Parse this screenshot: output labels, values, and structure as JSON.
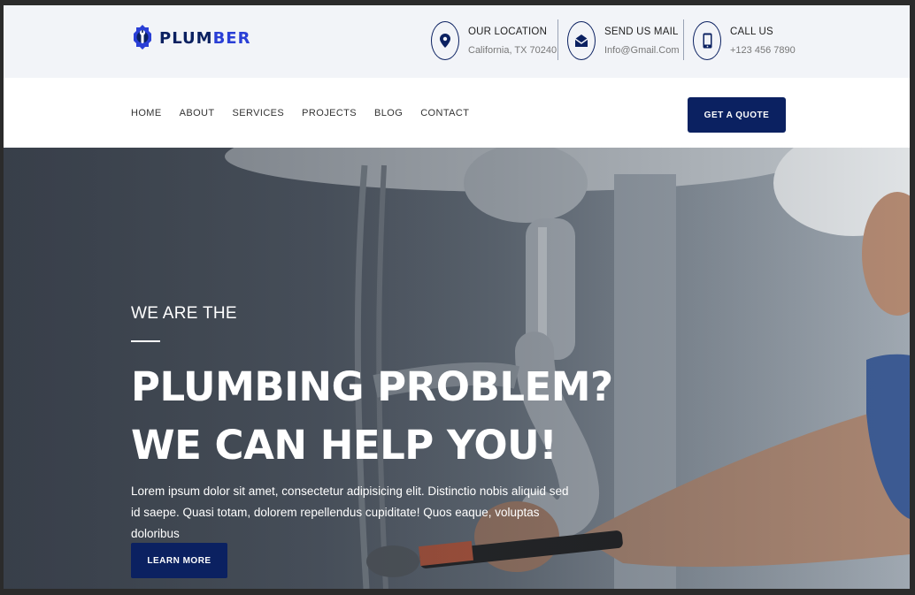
{
  "brand": {
    "name_part1": "PLUM",
    "name_part2": "BER",
    "primary_color": "#0b2161",
    "accent_color": "#2a3fd6"
  },
  "contact": [
    {
      "title": "OUR LOCATION",
      "detail": "California, TX 70240",
      "icon": "location-pin-icon"
    },
    {
      "title": "SEND US MAIL",
      "detail": "Info@Gmail.Com",
      "icon": "mail-icon"
    },
    {
      "title": "CALL US",
      "detail": "+123 456 7890",
      "icon": "phone-icon"
    }
  ],
  "nav": {
    "items": [
      "HOME",
      "ABOUT",
      "SERVICES",
      "PROJECTS",
      "BLOG",
      "CONTACT"
    ],
    "cta_label": "GET A QUOTE"
  },
  "hero": {
    "pre_title": "WE ARE THE",
    "headline_line1": "PLUMBING PROBLEM?",
    "headline_line2": "WE CAN HELP YOU!",
    "description": "Lorem ipsum dolor sit amet, consectetur adipisicing elit. Distinctio nobis aliquid sed id saepe. Quasi totam, dolorem repellendus cupiditate! Quos eaque, voluptas doloribus",
    "button_label": "LEARN MORE"
  }
}
